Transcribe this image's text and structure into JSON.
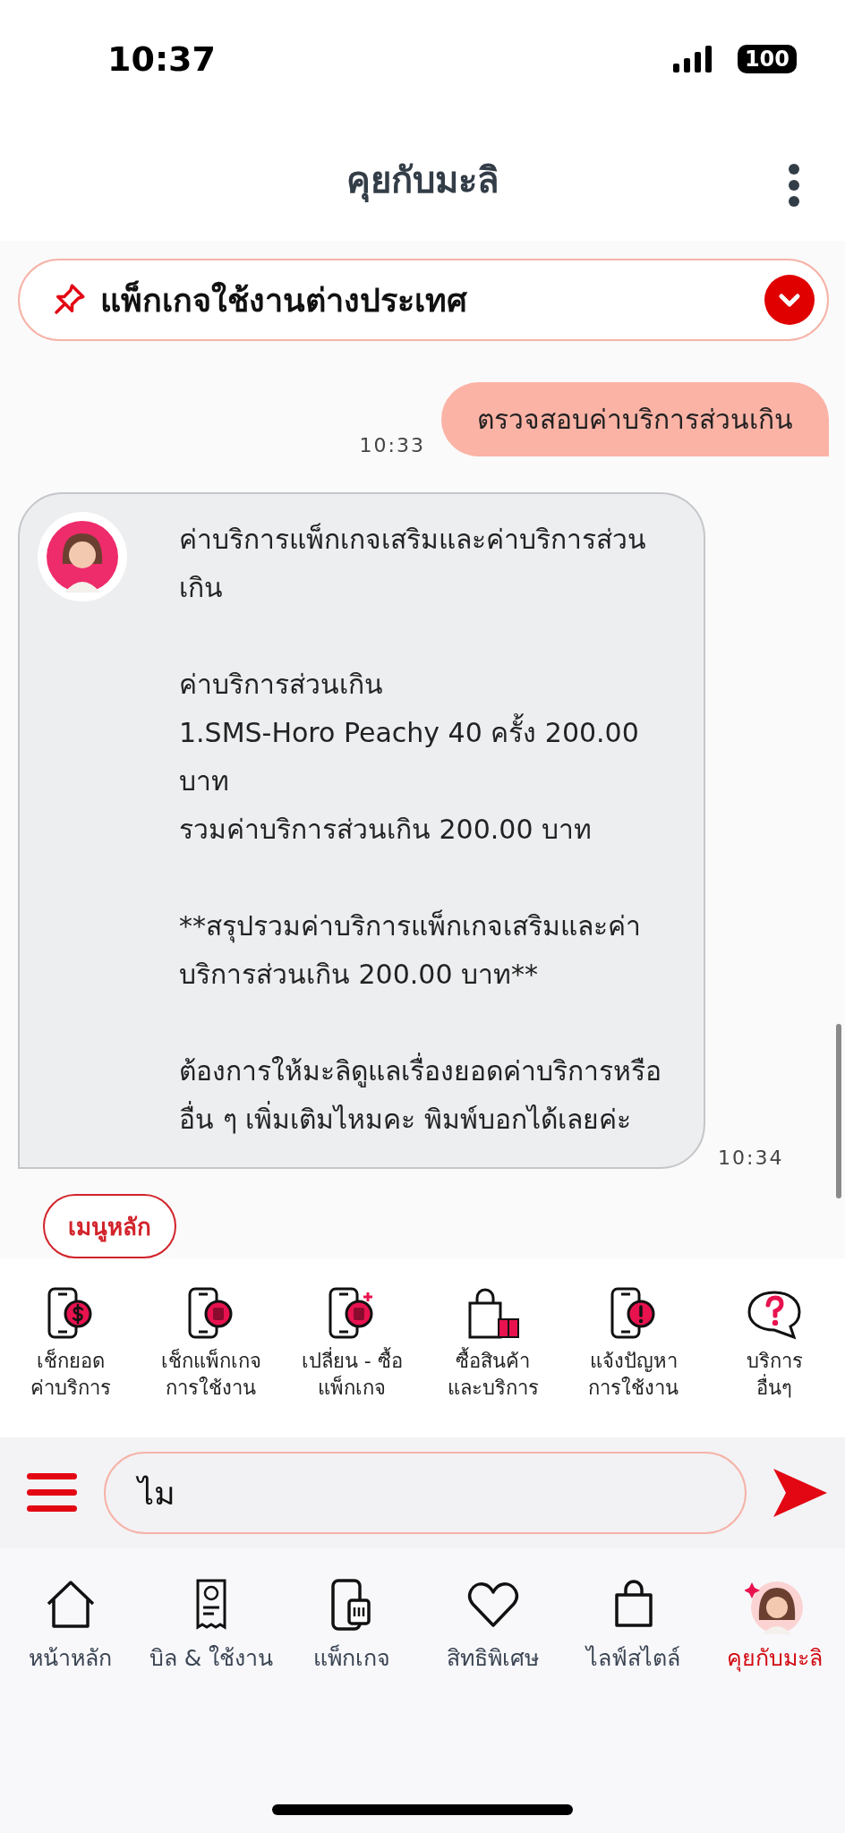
{
  "status_bar": {
    "time": "10:37",
    "battery": "100"
  },
  "header": {
    "title": "คุยกับมะลิ"
  },
  "pinned": {
    "title": "แพ็กเกจใช้งานต่างประเทศ",
    "expanded": false
  },
  "messages": [
    {
      "kind": "user",
      "time": "10:33",
      "paragraphs": [
        "ตรวจสอบค่าบริการส่วนเกิน"
      ]
    },
    {
      "kind": "bot",
      "time": "10:34",
      "paragraphs": [
        "ค่าบริการแพ็กเกจเสริมและค่าบริการส่วนเกิน",
        "ค่าบริการส่วนเกิน\n1.SMS-Horo Peachy 40 ครั้ง 200.00 บาท\nรวมค่าบริการส่วนเกิน 200.00 บาท",
        "**สรุปรวมค่าบริการแพ็กเกจเสริมและค่าบริการส่วนเกิน 200.00 บาท**",
        "ต้องการให้มะลิดูแลเรื่องยอดค่าบริการหรือ อื่น ๆ เพิ่มเติมไหมคะ พิมพ์บอกได้เลยค่ะ"
      ]
    }
  ],
  "main_menu_button": "เมนูหลัก",
  "quick_menu": [
    {
      "kind": "bill",
      "label": "เช็กยอด\nค่าบริการ"
    },
    {
      "kind": "package",
      "label": "เช็กแพ็กเกจ\nการใช้งาน"
    },
    {
      "kind": "change",
      "label": "เปลี่ยน - ซื้อ\nแพ็กเกจ"
    },
    {
      "kind": "shop",
      "label": "ซื้อสินค้า\nและบริการ"
    },
    {
      "kind": "problem",
      "label": "แจ้งปัญหา\nการใช้งาน"
    },
    {
      "kind": "other",
      "label": "บริการ\nอื่นๆ"
    }
  ],
  "input": {
    "value": "ไม"
  },
  "bottom_nav": [
    {
      "kind": "home",
      "label": "หน้าหลัก",
      "selected": false
    },
    {
      "kind": "bill",
      "label": "บิล & ใช้งาน",
      "selected": false
    },
    {
      "kind": "package",
      "label": "แพ็กเกจ",
      "selected": false
    },
    {
      "kind": "privilege",
      "label": "สิทธิพิเศษ",
      "selected": false
    },
    {
      "kind": "lifestyle",
      "label": "ไลฟ์สไตล์",
      "selected": false
    },
    {
      "kind": "chat",
      "label": "คุยกับมะลิ",
      "selected": true
    }
  ]
}
